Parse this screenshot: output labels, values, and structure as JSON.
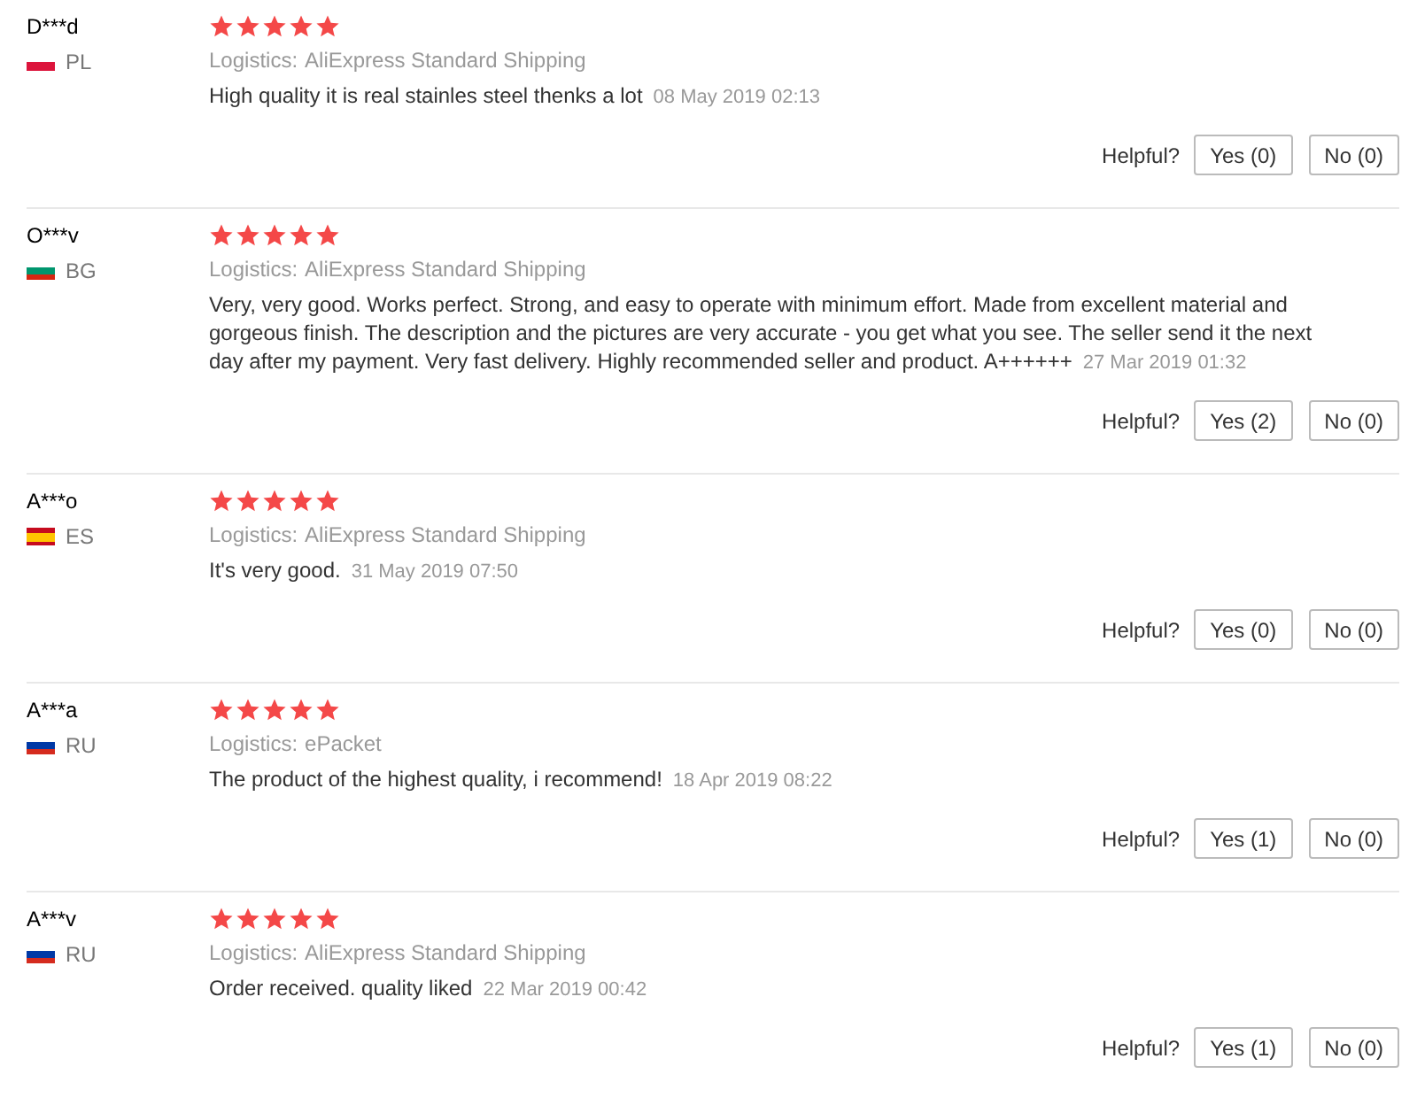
{
  "reviews": [
    {
      "name": "D***d",
      "country": "PL",
      "flag": [
        {
          "color": "#ffffff"
        },
        {
          "color": "#dc143c"
        }
      ],
      "stars": 5,
      "logistics_label": "Logistics:",
      "logistics": "AliExpress Standard Shipping",
      "text": "High quality it is real stainles steel thenks a lot",
      "date": "08 May 2019 02:13",
      "helpful_label": "Helpful?",
      "yes": "Yes (0)",
      "no": "No (0)"
    },
    {
      "name": "O***v",
      "country": "BG",
      "flag": [
        {
          "color": "#ffffff"
        },
        {
          "color": "#00966e"
        },
        {
          "color": "#d62612"
        }
      ],
      "stars": 5,
      "logistics_label": "Logistics:",
      "logistics": "AliExpress Standard Shipping",
      "text": "Very, very good. Works perfect. Strong, and easy to operate with minimum effort. Made from excellent material and gorgeous finish. The description and the pictures are very accurate - you get what you see. The seller send it the next day after my payment. Very fast delivery. Highly recommended seller and product. A++++++",
      "date": "27 Mar 2019 01:32",
      "helpful_label": "Helpful?",
      "yes": "Yes (2)",
      "no": "No (0)"
    },
    {
      "name": "A***o",
      "country": "ES",
      "flag": [
        {
          "color": "#c60b1e"
        },
        {
          "color": "#ffc400"
        },
        {
          "color": "#ffc400"
        },
        {
          "color": "#c60b1e"
        }
      ],
      "stars": 5,
      "logistics_label": "Logistics:",
      "logistics": "AliExpress Standard Shipping",
      "text": "It's very good.",
      "date": "31 May 2019 07:50",
      "helpful_label": "Helpful?",
      "yes": "Yes (0)",
      "no": "No (0)"
    },
    {
      "name": "A***a",
      "country": "RU",
      "flag": [
        {
          "color": "#ffffff"
        },
        {
          "color": "#0039a6"
        },
        {
          "color": "#d52b1e"
        }
      ],
      "stars": 5,
      "logistics_label": "Logistics:",
      "logistics": "ePacket",
      "text": "The product of the highest quality, i recommend!",
      "date": "18 Apr 2019 08:22",
      "helpful_label": "Helpful?",
      "yes": "Yes (1)",
      "no": "No (0)"
    },
    {
      "name": "A***v",
      "country": "RU",
      "flag": [
        {
          "color": "#ffffff"
        },
        {
          "color": "#0039a6"
        },
        {
          "color": "#d52b1e"
        }
      ],
      "stars": 5,
      "logistics_label": "Logistics:",
      "logistics": "AliExpress Standard Shipping",
      "text": "Order received. quality liked",
      "date": "22 Mar 2019 00:42",
      "helpful_label": "Helpful?",
      "yes": "Yes (1)",
      "no": "No (0)"
    }
  ]
}
